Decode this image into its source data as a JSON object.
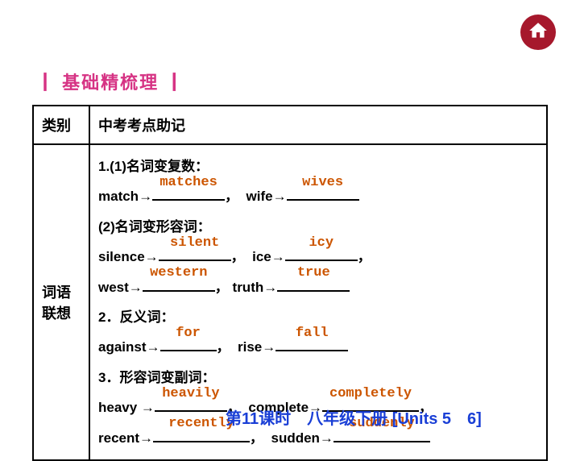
{
  "section_title": "┃ 基础精梳理 ┃",
  "home_icon": "home-icon",
  "table": {
    "header": {
      "col1": "类别",
      "col2": "中考考点助记"
    },
    "left_label": "词语\n联想",
    "items": {
      "line1": "1.(1)名词变复数：",
      "match_word": "match→",
      "match_ans": "matches",
      "wife_word": "wife→",
      "wife_ans": "wives",
      "line2": "(2)名词变形容词：",
      "silence_word": "silence→",
      "silence_ans": "silent",
      "ice_word": "ice→",
      "ice_ans": "icy",
      "west_word": "west→",
      "west_ans": "western",
      "truth_word": "truth→",
      "truth_ans": "true",
      "line3": "2．反义词：",
      "against_word": "against→",
      "against_ans": "for",
      "rise_word": "rise→",
      "rise_ans": "fall",
      "line4": "3．形容词变副词：",
      "heavy_word": "heavy →",
      "heavy_ans": "heavily",
      "complete_word": "complete→",
      "complete_ans": "completely",
      "recent_word": "recent→",
      "recent_ans": "recently",
      "sudden_word": "sudden→",
      "sudden_ans": "suddenly"
    }
  },
  "footer": "第11课时　八年级下册 [Units 5　6]"
}
